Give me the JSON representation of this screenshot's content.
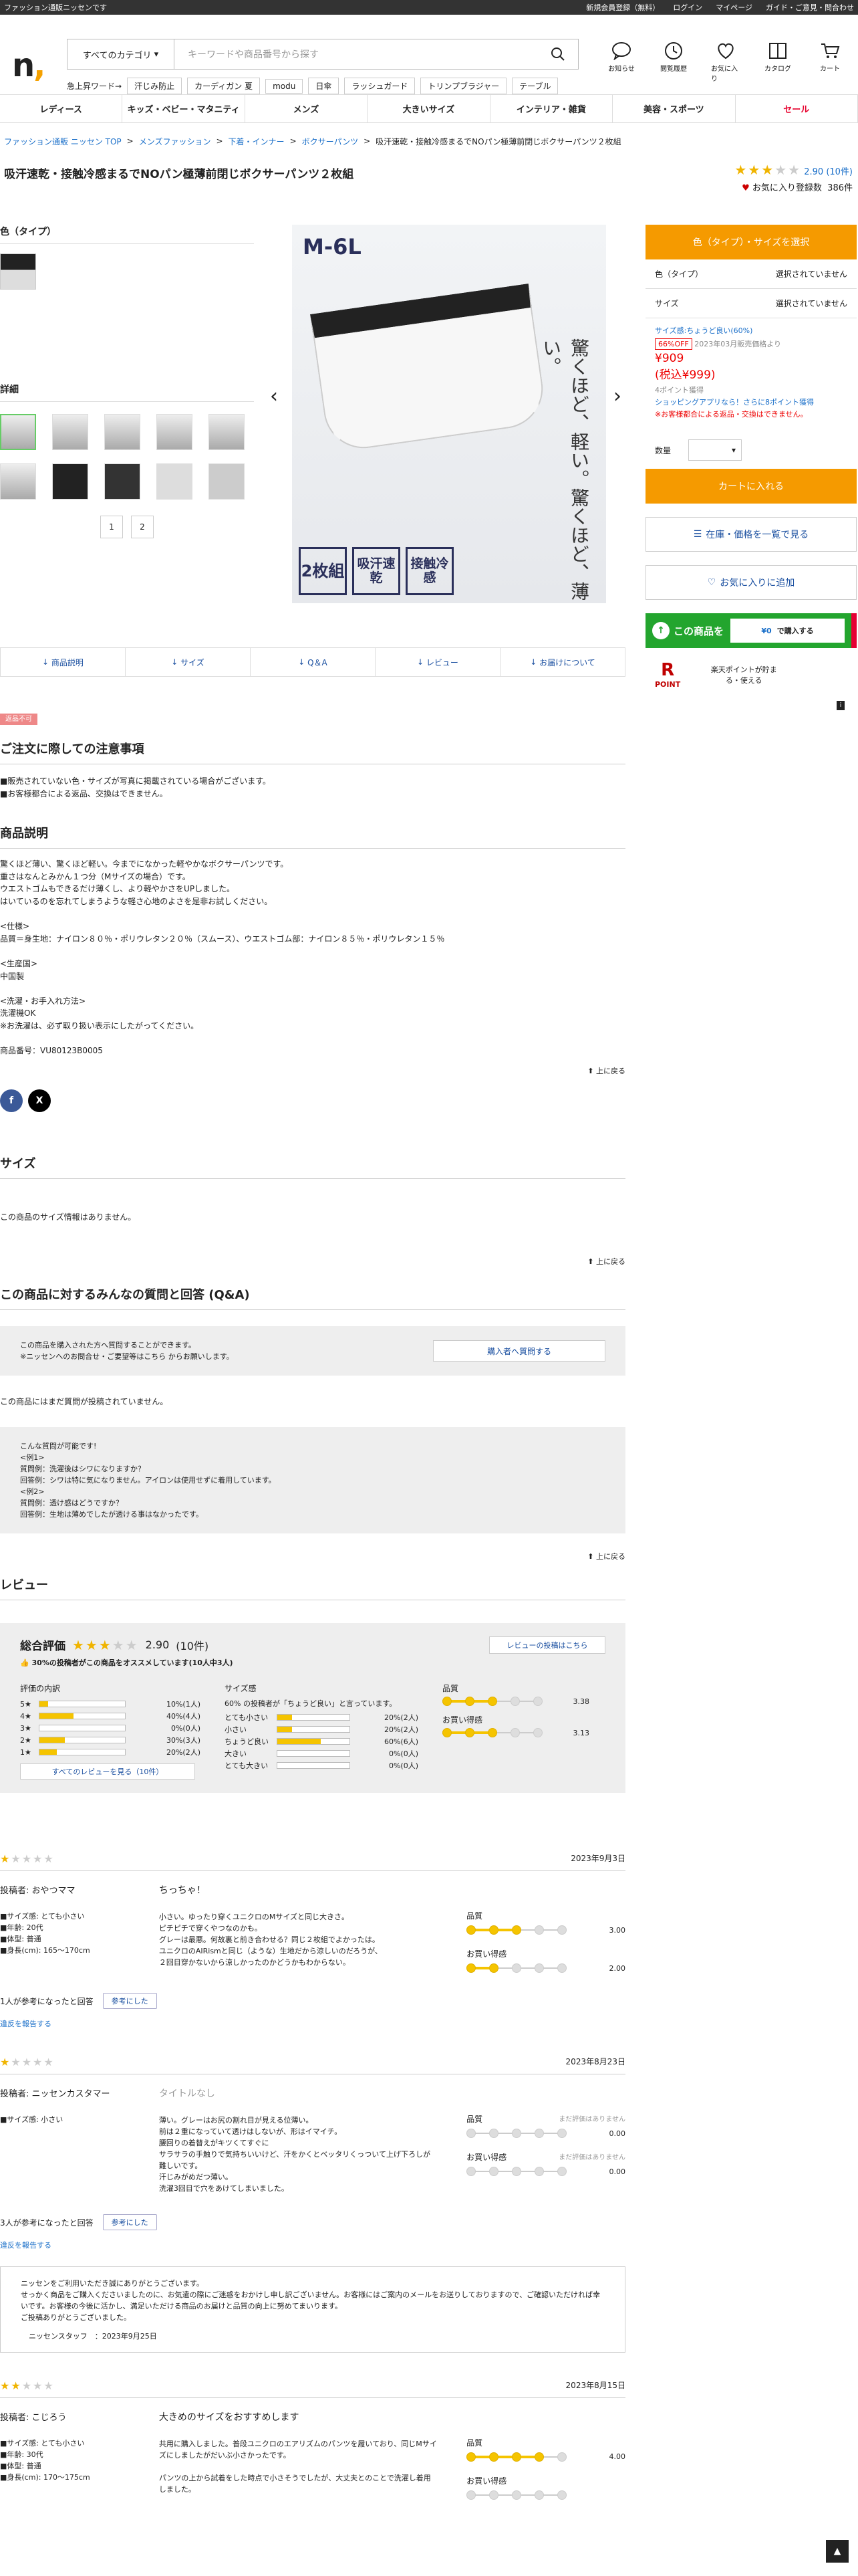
{
  "topbar": {
    "left": "ファッション通販ニッセンです",
    "links": [
      "新規会員登録（無料）",
      "ログイン",
      "マイページ",
      "ガイド・ご意見・問合わせ"
    ]
  },
  "header": {
    "category": "すべてのカテゴリ",
    "search_placeholder": "キーワードや商品番号から探す",
    "hot_label": "急上昇ワード→",
    "hot_words": [
      "汗じみ防止",
      "カーディガン 夏",
      "modu",
      "日傘",
      "ラッシュガード",
      "トリンプブラジャー",
      "テーブル"
    ],
    "icons": [
      "お知らせ",
      "閲覧履歴",
      "お気に入り",
      "カタログ",
      "カート"
    ]
  },
  "nav": [
    "レディース",
    "キッズ・ベビー・マタニティ",
    "メンズ",
    "大きいサイズ",
    "インテリア・雑貨",
    "美容・スポーツ",
    "セール"
  ],
  "breadcrumb": [
    "ファッション通販 ニッセン TOP",
    "メンズファッション",
    "下着・インナー",
    "ボクサーパンツ",
    "吸汗速乾・接触冷感まるでNOパン極薄前閉じボクサーパンツ２枚組"
  ],
  "product": {
    "title": "吸汗速乾・接触冷感まるでNOパン極薄前閉じボクサーパンツ２枚組",
    "rating": "2.90",
    "review_count": "(10件)",
    "fav_label": "お気に入り登録数",
    "fav_count": "386件",
    "color_label": "色（タイプ）",
    "detail_label": "詳細",
    "pages": [
      "1",
      "2"
    ],
    "image_size": "M-6L",
    "image_copy": "驚くほど、軽い。驚くほど、薄い。",
    "badges": [
      "2枚組",
      "吸汗速乾",
      "接触冷感"
    ]
  },
  "purchase": {
    "select_btn": "色（タイプ）・サイズを選択",
    "rows": [
      {
        "k": "色（タイプ）",
        "v": "選択されていません"
      },
      {
        "k": "サイズ",
        "v": "選択されていません"
      }
    ],
    "size_note": "サイズ感:ちょうど良い(60%)",
    "off": "66%OFF",
    "price_note": "2023年03月販売価格より",
    "price": "¥909",
    "price_tax": "(税込¥999)",
    "points": "4ポイント獲得",
    "app_note": "ショッピングアプリなら！さらに8ポイント獲得",
    "return_note": "※お客様都合による返品・交換はできません。",
    "qty_label": "数量",
    "cart_btn": "カートに入れる",
    "stock_btn": "在庫・価格を一覧で見る",
    "fav_btn": "お気に入りに追加",
    "banner_text": "この商品を",
    "banner_price": "¥0",
    "banner_suffix": "で購入する",
    "rpoint": "POINT",
    "rpoint_note": "楽天ポイントが貯まる・使える"
  },
  "tabs": [
    "商品説明",
    "サイズ",
    "Q＆A",
    "レビュー",
    "お届けについて"
  ],
  "desc": {
    "badge": "返品不可",
    "notice_title": "ご注文に際しての注意事項",
    "notice": "■販売されていない色・サイズが写真に掲載されている場合がございます。\n■お客様都合による返品、交換はできません。",
    "title": "商品説明",
    "body": "驚くほど薄い、驚くほど軽い。今までになかった軽やかなボクサーパンツです。\n重さはなんとみかん１つ分（Mサイズの場合）です。\nウエストゴムもできるだけ薄くし、より軽やかさをUPしました。\nはいているのを忘れてしまうような軽さ心地のよさを是非お試しください。\n\n<仕様>\n品質＝身生地：ナイロン８０％・ポリウレタン２０％（スムース）、ウエストゴム部：ナイロン８５％・ポリウレタン１５％\n\n<生産国>\n中国製\n\n<洗濯・お手入れ方法>\n洗濯機OK\n※お洗濯は、必ず取り扱い表示にしたがってください。\n\n商品番号：VU80123B0005",
    "up": "上に戻る"
  },
  "size": {
    "title": "サイズ",
    "body": "この商品のサイズ情報はありません。"
  },
  "qa": {
    "title": "この商品に対するみんなの質問と回答 (Q&A)",
    "box_text": "この商品を購入された方へ質問することができます。\n※ニッセンへのお問合せ・ご要望等はこちら からお願いします。",
    "ask_btn": "購入者へ質問する",
    "empty": "この商品にはまだ質問が投稿されていません。",
    "example": "こんな質問が可能です!\n<例1>\n質問例：洗濯後はシワになりますか？\n回答例：シワは特に気になりません。アイロンは使用せずに着用しています。\n<例2>\n質問例：透け感はどうですか？\n回答例：生地は薄めでしたが透ける事はなかったです。"
  },
  "reviews": {
    "title": "レビュー",
    "overall_label": "総合評価",
    "score": "2.90",
    "count": "(10件)",
    "post_btn": "レビューの投稿はこちら",
    "recommend": "30%の投稿者がこの商品をオススメしています(10人中3人)",
    "breakdown_title": "評価の内訳",
    "breakdown": [
      {
        "s": "5★",
        "p": 0.1,
        "t": "10%(1人)"
      },
      {
        "s": "4★",
        "p": 0.4,
        "t": "40%(4人)"
      },
      {
        "s": "3★",
        "p": 0,
        "t": "0%(0人)"
      },
      {
        "s": "2★",
        "p": 0.3,
        "t": "30%(3人)"
      },
      {
        "s": "1★",
        "p": 0.2,
        "t": "20%(2人)"
      }
    ],
    "all_btn": "すべてのレビューを見る（10件）",
    "size_title": "サイズ感",
    "size_note": "60% の投稿者が「ちょうど良い」と言っています。",
    "size_rows": [
      {
        "s": "とても小さい",
        "p": 0.2,
        "t": "20%(2人)"
      },
      {
        "s": "小さい",
        "p": 0.2,
        "t": "20%(2人)"
      },
      {
        "s": "ちょうど良い",
        "p": 0.6,
        "t": "60%(6人)"
      },
      {
        "s": "大きい",
        "p": 0,
        "t": "0%(0人)"
      },
      {
        "s": "とても大きい",
        "p": 0,
        "t": "0%(0人)"
      }
    ],
    "quality_label": "品質",
    "quality": "3.38",
    "value_label": "お買い得感",
    "value": "3.13",
    "items": [
      {
        "stars": 1,
        "date": "2023年9月3日",
        "poster": "投稿者: おやつママ",
        "info": "■サイズ感: とても小さい\n■年齢: 20代\n■体型: 普通\n■身長(cm): 165〜170cm",
        "headline": "ちっちゃ！",
        "body": "小さい。ゆったり穿くユニクロのMサイズと同じ大きさ。\nピチピチで穿くやつなのかも。\nグレーは最悪。何故裏と前き合わせる？同じ２枚組でよかったは。\nユニクロのAIRismと同じ（ような）生地だから涼しいのだろうが、\n２回目穿かないから涼しかったのかどうかもわからない。",
        "q": "3.00",
        "v": "2.00",
        "helpful": "1人が参考になったと回答",
        "helpful_btn": "参考にした",
        "report": "違反を報告する"
      },
      {
        "stars": 1,
        "date": "2023年8月23日",
        "poster": "投稿者: ニッセンカスタマー",
        "info": "■サイズ感: 小さい",
        "headline": "タイトルなし",
        "body": "薄い。グレーはお尻の割れ目が見える位薄い。\n前は２重になっていて透けはしないが、形はイマイチ。\n腰回りの着替えがキツくてすぐに\nサラサラの手触りで気持ちいいけど、汗をかくとベッタリくっついて上げ下ろしが難しいです。\n汗じみがめだつ薄い。\n洗濯3回目で穴をあけてしまいました。",
        "q": "0.00",
        "v": "0.00",
        "q_note": "まだ評価はありません",
        "v_note": "まだ評価はありません",
        "helpful": "3人が参考になったと回答",
        "helpful_btn": "参考にした",
        "report": "違反を報告する",
        "reply": "ニッセンをご利用いただき誠にありがとうございます。\nせっかく商品をご購入くださいましたのに、お気遣の際にご迷惑をおかけし申し訳ございません。お客様にはご案内のメールをお送りしておりますので、ご確認いただければ幸いです。お客様の今後に活かし、満足いただける商品のお届けと品質の向上に努めてまいります。\nご投稿ありがとうございました。",
        "reply_sig": "ニッセンスタッフ　：2023年9月25日"
      },
      {
        "stars": 2,
        "date": "2023年8月15日",
        "poster": "投稿者: こじろう",
        "info": "■サイズ感: とても小さい\n■年齢: 30代\n■体型: 普通\n■身長(cm): 170〜175cm",
        "headline": "大きめのサイズをおすすめします",
        "body": "共用に購入しました。普段ユニクロのエアリズムのパンツを履いており、同じMサイズにしましたがだいぶ小さかったです。\n\nパンツの上から試着をした時点で小さそうでしたが、大丈夫とのことで洗濯し着用しました。",
        "q": "4.00",
        "v": ""
      }
    ]
  }
}
